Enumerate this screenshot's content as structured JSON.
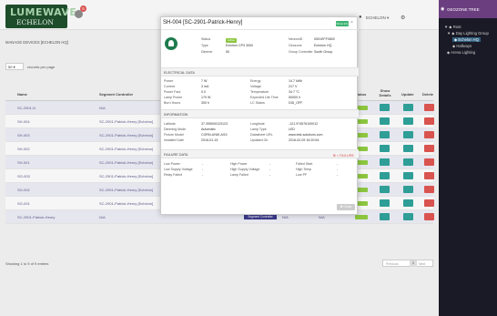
{
  "header": {
    "brand": "LUMEWAVE",
    "brand_sub": "ECHELON",
    "notif_count": "5",
    "user": "ECHELON",
    "user_menu": "ECHELON ▾"
  },
  "page": {
    "subtitle": "MANAGE DEVICES [ECHELON HQ]",
    "rows_value": "50",
    "rows_label": "records per page",
    "showing": "Showing 1 to 9 of 9 entries"
  },
  "table": {
    "headers": {
      "name": "Name",
      "segment": "Segment Controller",
      "status": "Status",
      "show_details": "Show Details",
      "update": "Update",
      "delete": "Delete"
    },
    "rows": [
      {
        "name": "SC-2901-N",
        "segment": "N/A"
      },
      {
        "name": "SH-004",
        "segment": "SC-2901-Patrick-Henry [Echelon]"
      },
      {
        "name": "SH-003",
        "segment": "SC-2901-Patrick-Henry [Echelon]"
      },
      {
        "name": "SH-002",
        "segment": "SC-2901-Patrick-Henry [Echelon]"
      },
      {
        "name": "SH-001",
        "segment": "SC-2901-Patrick-Henry [Echelon]"
      },
      {
        "name": "SG-003",
        "segment": "SC-2901-Patrick-Henry [Echelon]"
      },
      {
        "name": "SG-002",
        "segment": "SC-2901-Patrick-Henry [Echelon]"
      },
      {
        "name": "SG-001",
        "segment": "SC-2901-Patrick-Henry [Echelon]"
      },
      {
        "name": "SC-2901-Patrick-Henry",
        "segment": "N/A",
        "segment_btn": "Segment Controller",
        "na1": "N/A",
        "na2": "N/A"
      }
    ]
  },
  "pager": {
    "prev": "Previous",
    "page": "1",
    "next": "Next"
  },
  "right_panel": {
    "title": "GEOZONE TREE",
    "tree": [
      "▼ ◆ Root",
      "▼ ◆ Day Lighting Group",
      "◆ Echelon HQ",
      "◆ Hallways",
      "◆ Arena Lighting"
    ]
  },
  "modal": {
    "title": "SH-004 [SC-2901-Patrick-Henry]",
    "badge": "Show Info",
    "close": "×",
    "top": [
      [
        "Status",
        "Active",
        "NeuronID",
        "0501EFF0800"
      ],
      [
        "Type",
        "Echelon CP3 3000",
        "Geozone",
        "Echelon HQ"
      ],
      [
        "Dimmer",
        "50",
        "Group Controller",
        "South Group"
      ]
    ],
    "electrical_label": "ELECTRICAL DATA",
    "electrical": [
      [
        "Power",
        "7 W",
        "Energy",
        "14.7 kWh"
      ],
      [
        "Current",
        "3 mA",
        "Voltage",
        "217 V"
      ],
      [
        "Power Fact.",
        "0.0",
        "Temperature",
        "34.7 °C"
      ],
      [
        "Lamp Power",
        "170 W",
        "Expected Life Time",
        "50000 h"
      ],
      [
        "Burn Hours",
        "300 h",
        "LC Status",
        "DID_OFF"
      ]
    ],
    "information_label": "INFORMATION",
    "information": [
      [
        "Latitude",
        "37.395000123123",
        "Longitude",
        "-121.974576100012"
      ],
      [
        "Dimming Mode",
        "Automatic",
        "Lamp Type",
        "LED"
      ],
      [
        "Fixture Model",
        "CORN-UNIK-ASX",
        "Datasheet URL",
        "www.test-solutions.com"
      ],
      [
        "Installed Date",
        "2016-01-15",
        "Updated On",
        "2016-02-09 16:20:54"
      ]
    ],
    "failure_label": "FAILURE DATA",
    "failure_flag": "⊗ = FAILURE",
    "failure": [
      [
        "Low Power",
        "-",
        "High Power",
        "-",
        "Failed Start",
        "-"
      ],
      [
        "Low Supply Voltage",
        "-",
        "High Supply Voltage",
        "-",
        "High Temp",
        "-"
      ],
      [
        "Relay Failed",
        "-",
        "Lamp Failed",
        "-",
        "Low PF",
        "-"
      ]
    ],
    "close_btn": "✖ Close"
  }
}
